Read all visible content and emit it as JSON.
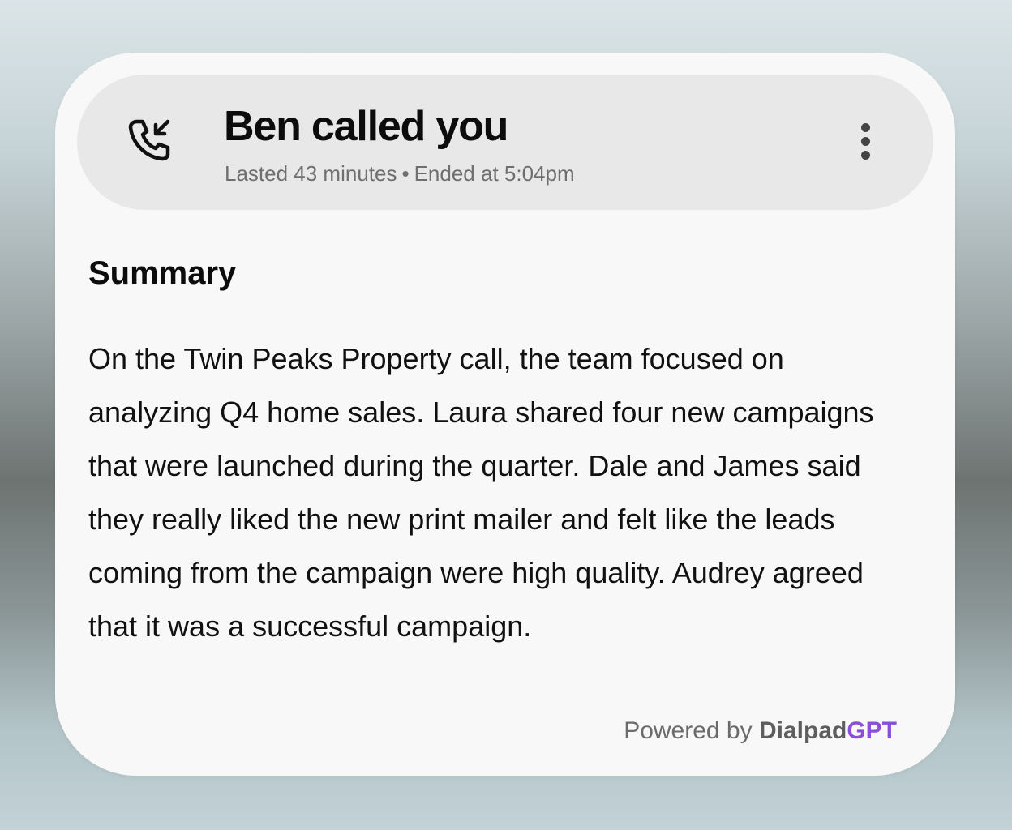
{
  "header": {
    "icon": "incoming-call-icon",
    "title": "Ben called you",
    "duration": "Lasted 43 minutes",
    "separator": "•",
    "ended": "Ended at 5:04pm",
    "menu_icon": "more-vertical-icon"
  },
  "summary": {
    "heading": "Summary",
    "text": "On the Twin Peaks Property call, the team focused on analyzing Q4 home sales. Laura shared four new campaigns that were launched during the quarter. Dale and James said they really liked the new print mailer and felt like the leads coming from the campaign were high quality. Audrey agreed that it was a successful campaign."
  },
  "footer": {
    "prefix": "Powered by",
    "brand": "Dialpad",
    "brand_suffix": "GPT"
  },
  "colors": {
    "card_background": "#f8f8f8",
    "header_background": "#e8e8e8",
    "accent_gpt": "#8b4fd8"
  }
}
